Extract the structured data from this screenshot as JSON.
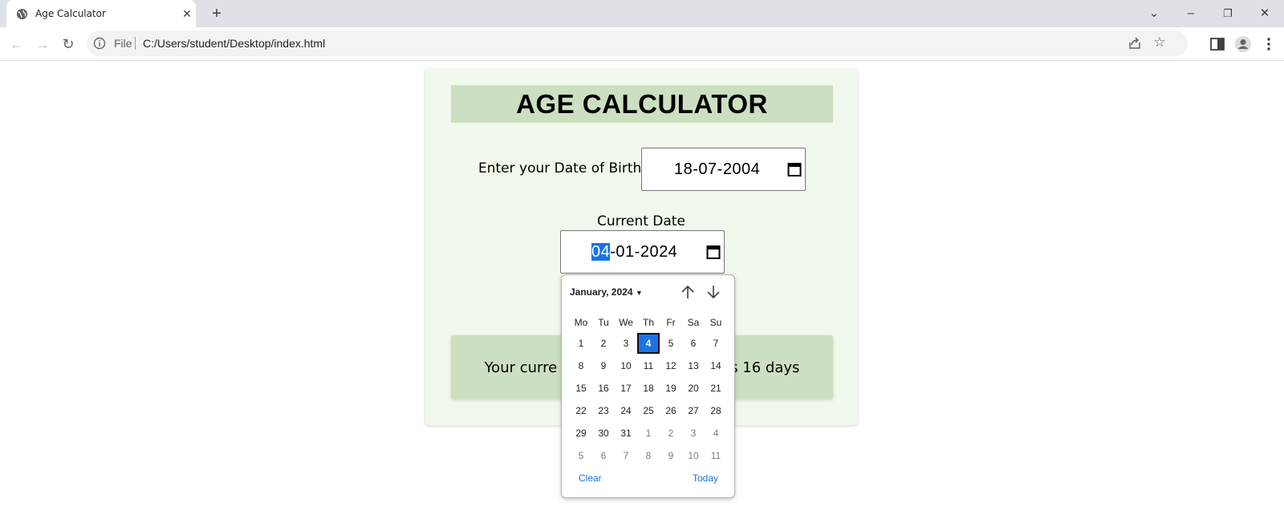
{
  "browser": {
    "tab_title": "Age Calculator",
    "tab_close": "✕",
    "new_tab": "+",
    "address_scheme": "File",
    "address_url": "C:/Users/student/Desktop/index.html",
    "back": "←",
    "forward": "→",
    "reload": "↻",
    "star": "☆",
    "window_controls": {
      "tab_list": "⌄",
      "minimize": "–",
      "restore": "❐",
      "close": "✕"
    }
  },
  "page": {
    "heading": "AGE CALCULATOR",
    "dob_label": "Enter your Date of Birth",
    "dob_value": "18-07-2004",
    "current_label": "Current Date",
    "current_day": "04",
    "current_rest": "-01-2024",
    "result_left": "Your curre",
    "result_right": "s 16 days"
  },
  "picker": {
    "month_label": "January, 2024",
    "weekdays": [
      "Mo",
      "Tu",
      "We",
      "Th",
      "Fr",
      "Sa",
      "Su"
    ],
    "weeks": [
      [
        "1",
        "2",
        "3",
        "4",
        "5",
        "6",
        "7"
      ],
      [
        "8",
        "9",
        "10",
        "11",
        "12",
        "13",
        "14"
      ],
      [
        "15",
        "16",
        "17",
        "18",
        "19",
        "20",
        "21"
      ],
      [
        "22",
        "23",
        "24",
        "25",
        "26",
        "27",
        "28"
      ],
      [
        "29",
        "30",
        "31",
        "1",
        "2",
        "3",
        "4"
      ],
      [
        "5",
        "6",
        "7",
        "8",
        "9",
        "10",
        "11"
      ]
    ],
    "selected_day": "4",
    "clear": "Clear",
    "today": "Today"
  },
  "colors": {
    "card_bg": "#f1f9ec",
    "heading_bg": "#cddfc1",
    "accent": "#1a73e8"
  }
}
